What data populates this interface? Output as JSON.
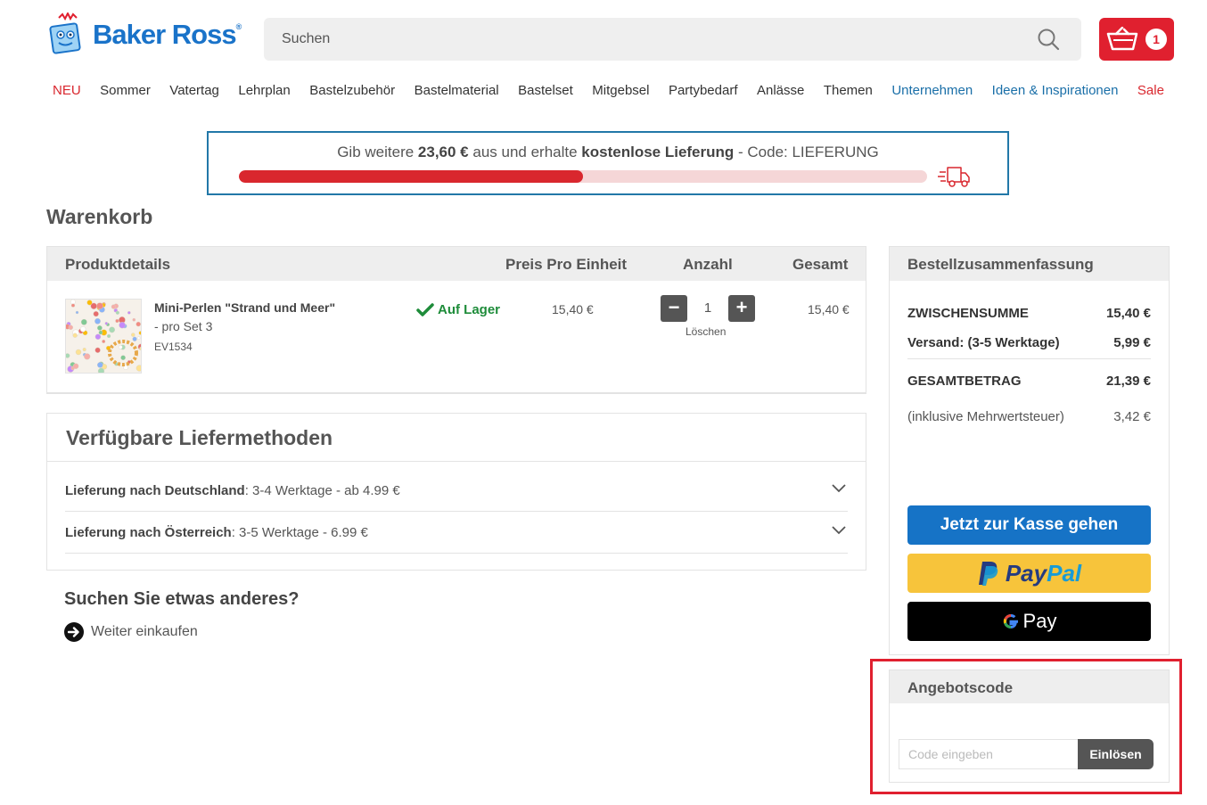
{
  "brand": {
    "name": "Baker Ross",
    "reg": "®",
    "color": "#1a73c9"
  },
  "search": {
    "placeholder": "Suchen"
  },
  "cart": {
    "count": "1"
  },
  "nav": [
    {
      "label": "NEU",
      "style": "red"
    },
    {
      "label": "Sommer",
      "style": ""
    },
    {
      "label": "Vatertag",
      "style": ""
    },
    {
      "label": "Lehrplan",
      "style": ""
    },
    {
      "label": "Bastelzubehör",
      "style": ""
    },
    {
      "label": "Bastelmaterial",
      "style": ""
    },
    {
      "label": "Bastelset",
      "style": ""
    },
    {
      "label": "Mitgebsel",
      "style": ""
    },
    {
      "label": "Partybedarf",
      "style": ""
    },
    {
      "label": "Anlässe",
      "style": ""
    },
    {
      "label": "Themen",
      "style": ""
    },
    {
      "label": "Unternehmen",
      "style": "blue"
    },
    {
      "label": "Ideen & Inspirationen",
      "style": "blue"
    },
    {
      "label": "Sale",
      "style": "red"
    }
  ],
  "banner": {
    "prefix": "Gib weitere ",
    "amount": "23,60 €",
    "middle": " aus und erhalte ",
    "highlight": "kostenlose Lieferung",
    "suffix": " - Code: LIEFERUNG",
    "progress": 0.5
  },
  "page_title": "Warenkorb",
  "table": {
    "headers": {
      "product": "Produktdetails",
      "unit": "Preis Pro Einheit",
      "qty": "Anzahl",
      "total": "Gesamt"
    },
    "item": {
      "name": "Mini-Perlen \"Strand und Meer\"",
      "variant": "- pro Set 3",
      "sku": "EV1534",
      "stock": "Auf Lager",
      "unit_price": "15,40 €",
      "qty": "1",
      "total": "15,40 €",
      "delete": "Löschen"
    }
  },
  "delivery": {
    "title": "Verfügbare Liefermethoden",
    "rows": [
      {
        "label": "Lieferung nach Deutschland",
        "detail": ": 3-4 Werktage - ab 4.99 €"
      },
      {
        "label": "Lieferung nach Österreich",
        "detail": ": 3-5 Werktage - 6.99 €"
      }
    ]
  },
  "other": {
    "title": "Suchen Sie etwas anderes?",
    "link": "Weiter einkaufen"
  },
  "summary": {
    "title": "Bestellzusammenfassung",
    "subtotal_label": "ZWISCHENSUMME",
    "subtotal": "15,40 €",
    "shipping_label": "Versand: (3-5 Werktage)",
    "shipping": "5,99 €",
    "grand_label": "GESAMTBETRAG",
    "grand": "21,39 €",
    "vat_label": "(inklusive Mehrwertsteuer)",
    "vat": "3,42 €",
    "checkout": "Jetzt zur Kasse gehen",
    "paypal_a": "Pay",
    "paypal_b": "Pal",
    "gpay": "Pay"
  },
  "coupon": {
    "title": "Angebotscode",
    "placeholder": "Code eingeben",
    "button": "Einlösen"
  }
}
